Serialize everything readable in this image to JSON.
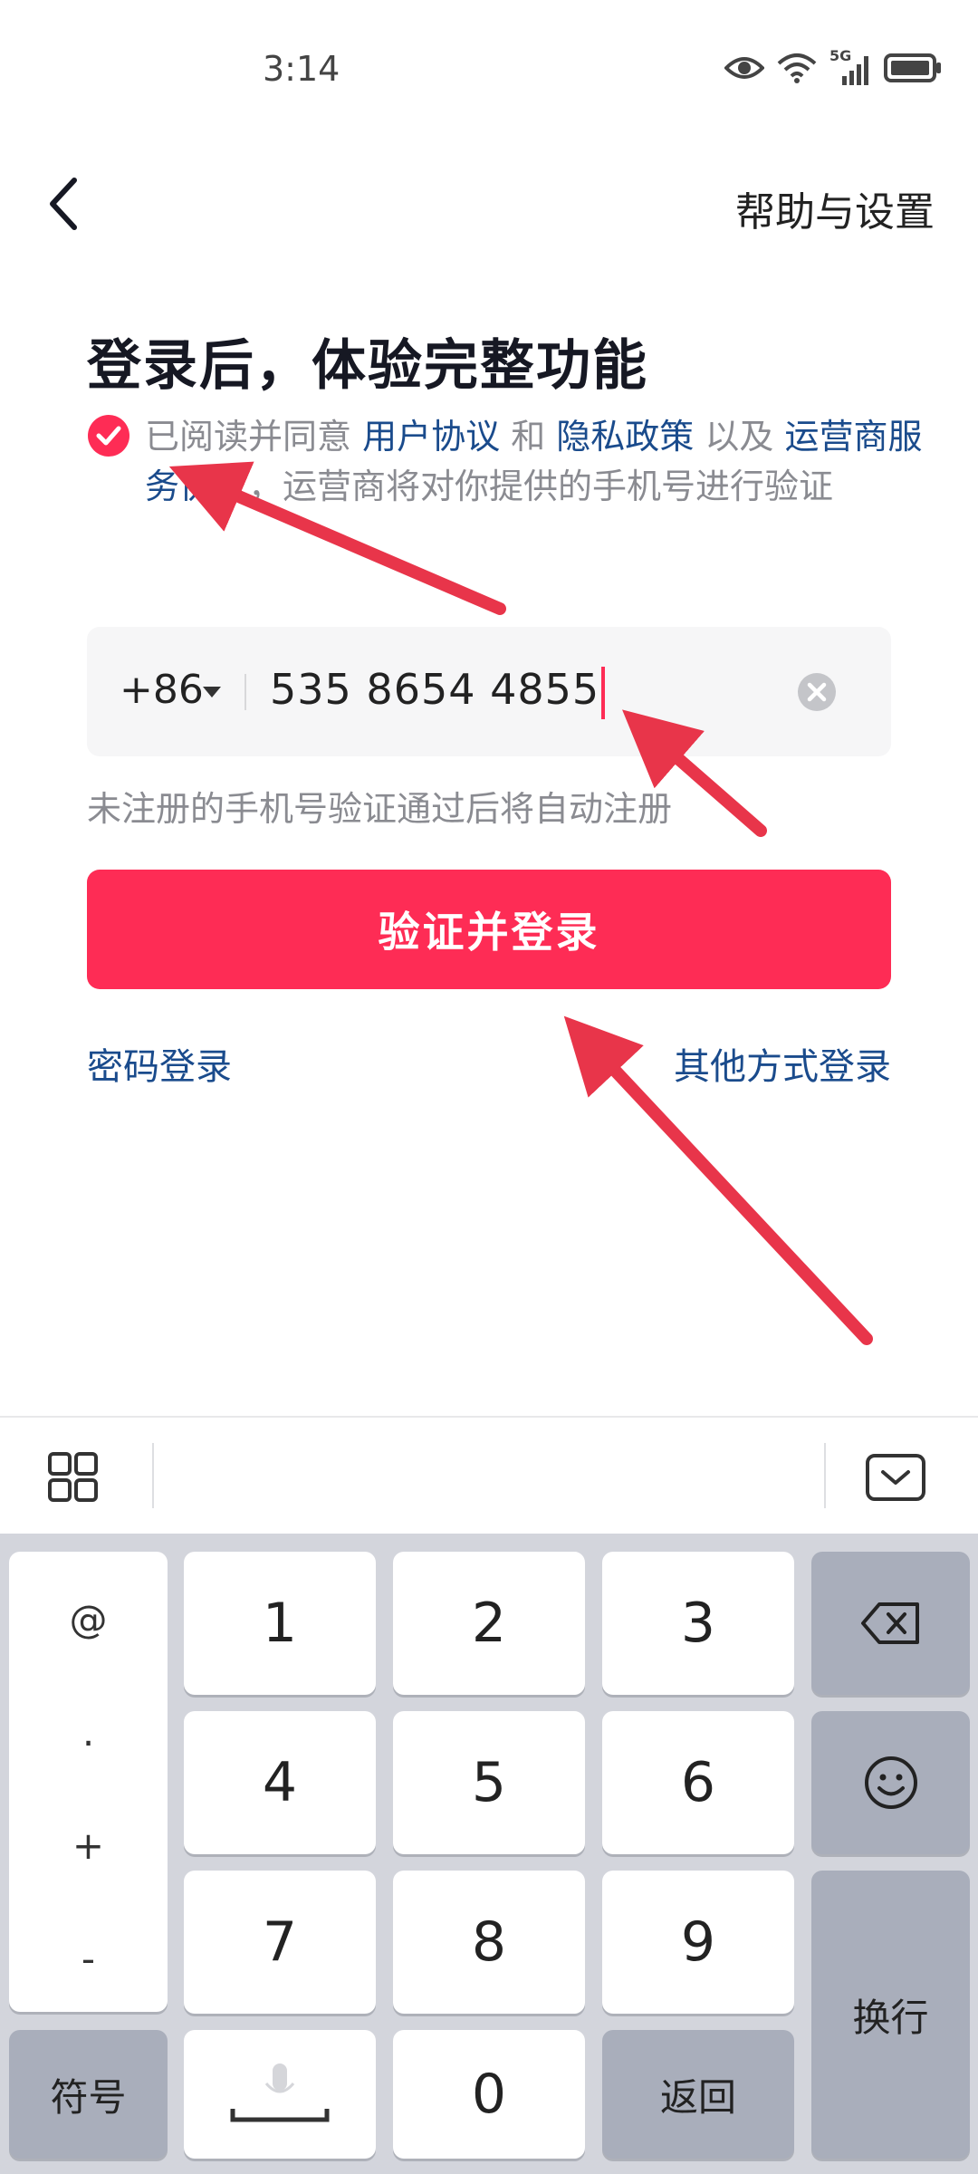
{
  "status_bar": {
    "time": "3:14",
    "icons": [
      "eye-icon",
      "wifi-icon",
      "5g-signal-icon",
      "battery-icon"
    ],
    "network_label": "5G"
  },
  "header": {
    "back_icon": "chevron-left-icon",
    "help_label": "帮助与设置"
  },
  "title": "登录后，体验完整功能",
  "agreement": {
    "checked": true,
    "prefix": "已阅读并同意 ",
    "user_agreement": "用户协议",
    "and": " 和 ",
    "privacy_policy": "隐私政策",
    "as_well_as": " 以及 ",
    "carrier_agreement": "运营商服务协议",
    "suffix": "，运营商将对你提供的手机号进行验证"
  },
  "phone": {
    "country_code": "+86",
    "value": "535 8654 4855"
  },
  "hint": "未注册的手机号验证通过后将自动注册",
  "login_button": "验证并登录",
  "password_login": "密码登录",
  "other_login": "其他方式登录",
  "colors": {
    "accent": "#fe2c55",
    "link": "#1a4b8c",
    "arrow": "#e8354a"
  },
  "keyboard": {
    "toolbar_icons": [
      "grid-icon",
      "keyboard-hide-icon"
    ],
    "symbols": [
      "@",
      ".",
      "+",
      "-"
    ],
    "keys": [
      "1",
      "2",
      "3",
      "4",
      "5",
      "6",
      "7",
      "8",
      "9",
      "0"
    ],
    "symbols_key": "符号",
    "return_key": "返回",
    "newline_key": "换行",
    "backspace_icon": "backspace-icon",
    "emoji_icon": "emoji-icon",
    "mic_icon": "mic-icon"
  }
}
